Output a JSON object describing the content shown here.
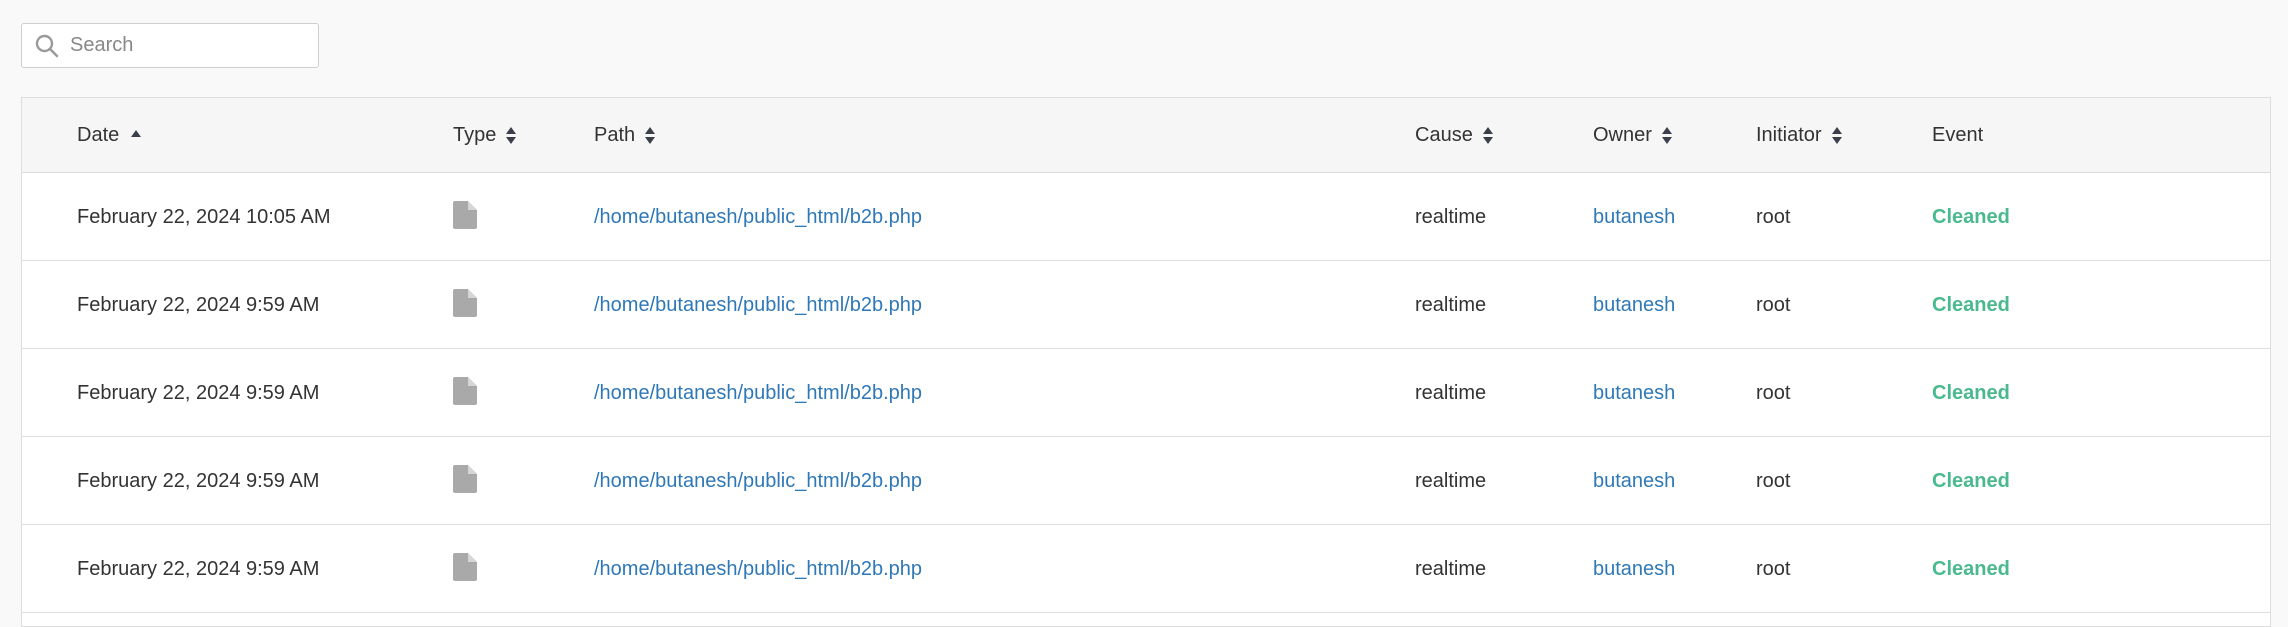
{
  "search": {
    "placeholder": "Search",
    "value": ""
  },
  "table": {
    "columns": [
      {
        "label": "Date",
        "sort": "ascending"
      },
      {
        "label": "Type",
        "sort": "sortable"
      },
      {
        "label": "Path",
        "sort": "sortable"
      },
      {
        "label": "Cause",
        "sort": "sortable"
      },
      {
        "label": "Owner",
        "sort": "sortable"
      },
      {
        "label": "Initiator",
        "sort": "sortable"
      },
      {
        "label": "Event",
        "sort": "none"
      }
    ],
    "rows": [
      {
        "date": "February 22, 2024 10:05 AM",
        "type_icon": "file-icon",
        "path": "/home/butanesh/public_html/b2b.php",
        "cause": "realtime",
        "owner": "butanesh",
        "initiator": "root",
        "event": "Cleaned"
      },
      {
        "date": "February 22, 2024 9:59 AM",
        "type_icon": "file-icon",
        "path": "/home/butanesh/public_html/b2b.php",
        "cause": "realtime",
        "owner": "butanesh",
        "initiator": "root",
        "event": "Cleaned"
      },
      {
        "date": "February 22, 2024 9:59 AM",
        "type_icon": "file-icon",
        "path": "/home/butanesh/public_html/b2b.php",
        "cause": "realtime",
        "owner": "butanesh",
        "initiator": "root",
        "event": "Cleaned"
      },
      {
        "date": "February 22, 2024 9:59 AM",
        "type_icon": "file-icon",
        "path": "/home/butanesh/public_html/b2b.php",
        "cause": "realtime",
        "owner": "butanesh",
        "initiator": "root",
        "event": "Cleaned"
      },
      {
        "date": "February 22, 2024 9:59 AM",
        "type_icon": "file-icon",
        "path": "/home/butanesh/public_html/b2b.php",
        "cause": "realtime",
        "owner": "butanesh",
        "initiator": "root",
        "event": "Cleaned"
      }
    ]
  },
  "colors": {
    "link": "#2f78b7",
    "status_cleaned": "#4aba8e",
    "header_bg": "#f6f6f6",
    "border": "#dddddd"
  }
}
